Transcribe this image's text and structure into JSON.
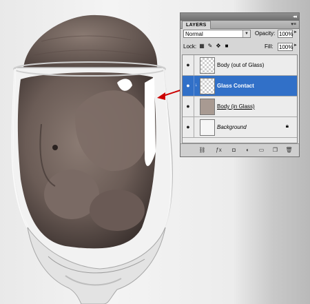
{
  "panel": {
    "title_arrows": "◂◂",
    "tab_label": "LAYERS",
    "menu_icon": "panel-menu-icon",
    "blend_mode": "Normal",
    "opacity_label": "Opacity:",
    "opacity_value": "100%",
    "lock_label": "Lock:",
    "fill_label": "Fill:",
    "fill_value": "100%"
  },
  "layers": [
    {
      "name": "Body (out of Glass)",
      "visible": true,
      "selected": false
    },
    {
      "name": "Glass Contact",
      "visible": true,
      "selected": true
    },
    {
      "name": "Body (in Glass)",
      "visible": true,
      "selected": false
    },
    {
      "name": "Background",
      "visible": true,
      "selected": false,
      "locked": true
    }
  ],
  "footer_icons": [
    "link-layers-icon",
    "fx-icon",
    "mask-icon",
    "adjustment-icon",
    "group-icon",
    "new-layer-icon",
    "trash-icon"
  ],
  "colors": {
    "selection": "#3170c8",
    "annotation_arrow": "#cc0000"
  }
}
